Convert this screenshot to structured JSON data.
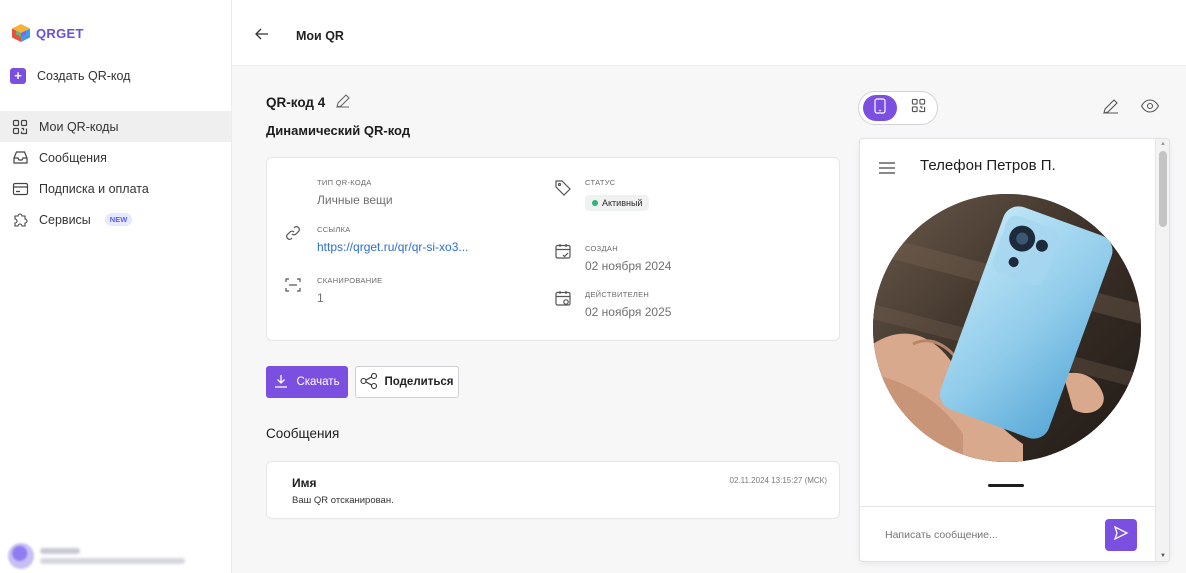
{
  "app": {
    "logo_text": "QRGET"
  },
  "sidebar": {
    "create_label": "Создать QR-код",
    "items": [
      {
        "label": "Мои QR-коды",
        "icon": "qr-grid-icon",
        "active": true
      },
      {
        "label": "Сообщения",
        "icon": "inbox-icon"
      },
      {
        "label": "Подписка и оплата",
        "icon": "card-icon"
      },
      {
        "label": "Сервисы",
        "icon": "puzzle-icon",
        "badge": "NEW"
      }
    ]
  },
  "header": {
    "title": "Мои QR"
  },
  "qr": {
    "title": "QR-код 4",
    "subtitle": "Динамический QR-код",
    "type_label": "ТИП QR-КОДА",
    "type_value": "Личные вещи",
    "link_label": "ССЫЛКА",
    "link_value": "https://qrget.ru/qr/qr-si-xo3...",
    "scan_label": "СКАНИРОВАНИЕ",
    "scan_value": "1",
    "status_label": "СТАТУС",
    "status_value": "Активный",
    "created_label": "СОЗДАН",
    "created_value": "02 ноября 2024",
    "valid_label": "ДЕЙСТВИТЕЛЕН",
    "valid_value": "02 ноября 2025"
  },
  "actions": {
    "download": "Скачать",
    "share": "Поделиться"
  },
  "messages": {
    "title": "Сообщения",
    "items": [
      {
        "name": "Имя",
        "text": "Ваш QR отсканирован.",
        "time": "02.11.2024 13:15:27 (МСК)"
      }
    ]
  },
  "preview": {
    "title": "Телефон Петров П.",
    "input_placeholder": "Написать сообщение..."
  },
  "colors": {
    "accent": "#7b4fe0",
    "status_active": "#2bb673",
    "link": "#2c6ed8"
  }
}
